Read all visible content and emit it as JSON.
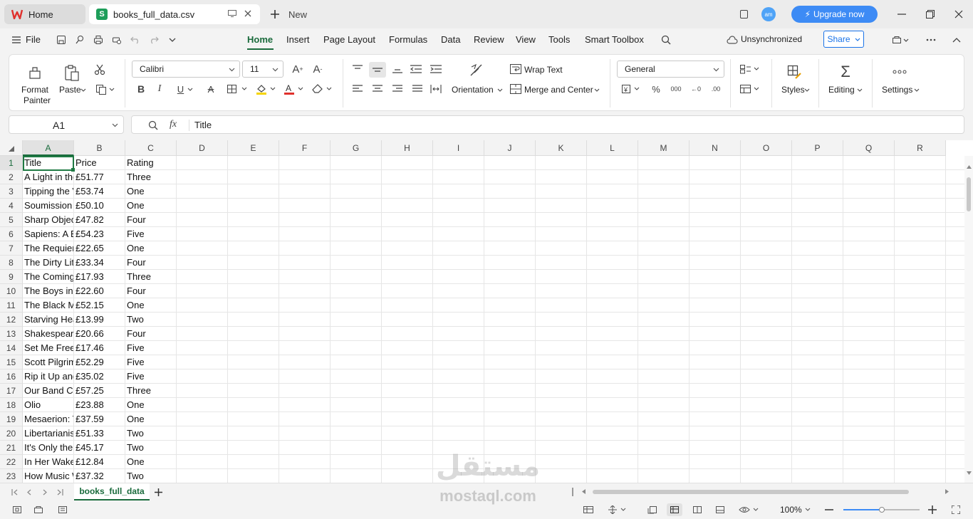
{
  "tabs": {
    "home_label": "Home",
    "file_label": "books_full_data.csv",
    "new_label": "New"
  },
  "titlebar": {
    "avatar_initials": "am",
    "upgrade_label": "Upgrade now"
  },
  "menubar": {
    "file_label": "File",
    "items": [
      "Home",
      "Insert",
      "Page Layout",
      "Formulas",
      "Data",
      "Review",
      "View",
      "Tools",
      "Smart Toolbox"
    ],
    "sync_label": "Unsynchronized",
    "share_label": "Share"
  },
  "ribbon": {
    "format_painter_line1": "Format",
    "format_painter_line2": "Painter",
    "paste_label": "Paste",
    "font_name": "Calibri",
    "font_size": "11",
    "wrap_text_label": "Wrap Text",
    "orientation_label": "Orientation",
    "merge_label": "Merge and Center",
    "number_format": "General",
    "styles_label": "Styles",
    "editing_label": "Editing",
    "settings_label": "Settings"
  },
  "formula": {
    "cell_ref": "A1",
    "fx_label": "fx",
    "content": "Title"
  },
  "grid": {
    "columns": [
      "A",
      "B",
      "C",
      "D",
      "E",
      "F",
      "G",
      "H",
      "I",
      "J",
      "K",
      "L",
      "M",
      "N",
      "O",
      "P",
      "Q",
      "R"
    ],
    "rows": [
      [
        "Title",
        "Price",
        "Rating"
      ],
      [
        "A Light in the Attic",
        "£51.77",
        "Three"
      ],
      [
        "Tipping the Velvet",
        "£53.74",
        "One"
      ],
      [
        "Soumission",
        "£50.10",
        "One"
      ],
      [
        "Sharp Objects",
        "£47.82",
        "Four"
      ],
      [
        "Sapiens: A Brief History",
        "£54.23",
        "Five"
      ],
      [
        "The Requiem Red",
        "£22.65",
        "One"
      ],
      [
        "The Dirty Little Secrets",
        "£33.34",
        "Four"
      ],
      [
        "The Coming Woman",
        "£17.93",
        "Three"
      ],
      [
        "The Boys in the Boat",
        "£22.60",
        "Four"
      ],
      [
        "The Black Maria",
        "£52.15",
        "One"
      ],
      [
        "Starving Hearts",
        "£13.99",
        "Two"
      ],
      [
        "Shakespeare's Sonnets",
        "£20.66",
        "Four"
      ],
      [
        "Set Me Free",
        "£17.46",
        "Five"
      ],
      [
        "Scott Pilgrim's Precious",
        "£52.29",
        "Five"
      ],
      [
        "Rip it Up and Start Again",
        "£35.02",
        "Five"
      ],
      [
        "Our Band Could Be Your Life",
        "£57.25",
        "Three"
      ],
      [
        "Olio",
        "£23.88",
        "One"
      ],
      [
        "Mesaerion: The Best",
        "£37.59",
        "One"
      ],
      [
        "Libertarianism for Beginners",
        "£51.33",
        "Two"
      ],
      [
        "It's Only the Himalayas",
        "£45.17",
        "Two"
      ],
      [
        "In Her Wake",
        "£12.84",
        "One"
      ],
      [
        "How Music Works",
        "£37.32",
        "Two"
      ]
    ]
  },
  "sheets": {
    "active": "books_full_data"
  },
  "status": {
    "zoom": "100%"
  },
  "watermark": {
    "arabic": "مستقل",
    "latin": "mostaql.com"
  },
  "colors": {
    "accent": "#1a6b3c",
    "upgrade": "#3d8bf5",
    "share_border": "#1a73e8",
    "selection": "#1f7a44"
  }
}
